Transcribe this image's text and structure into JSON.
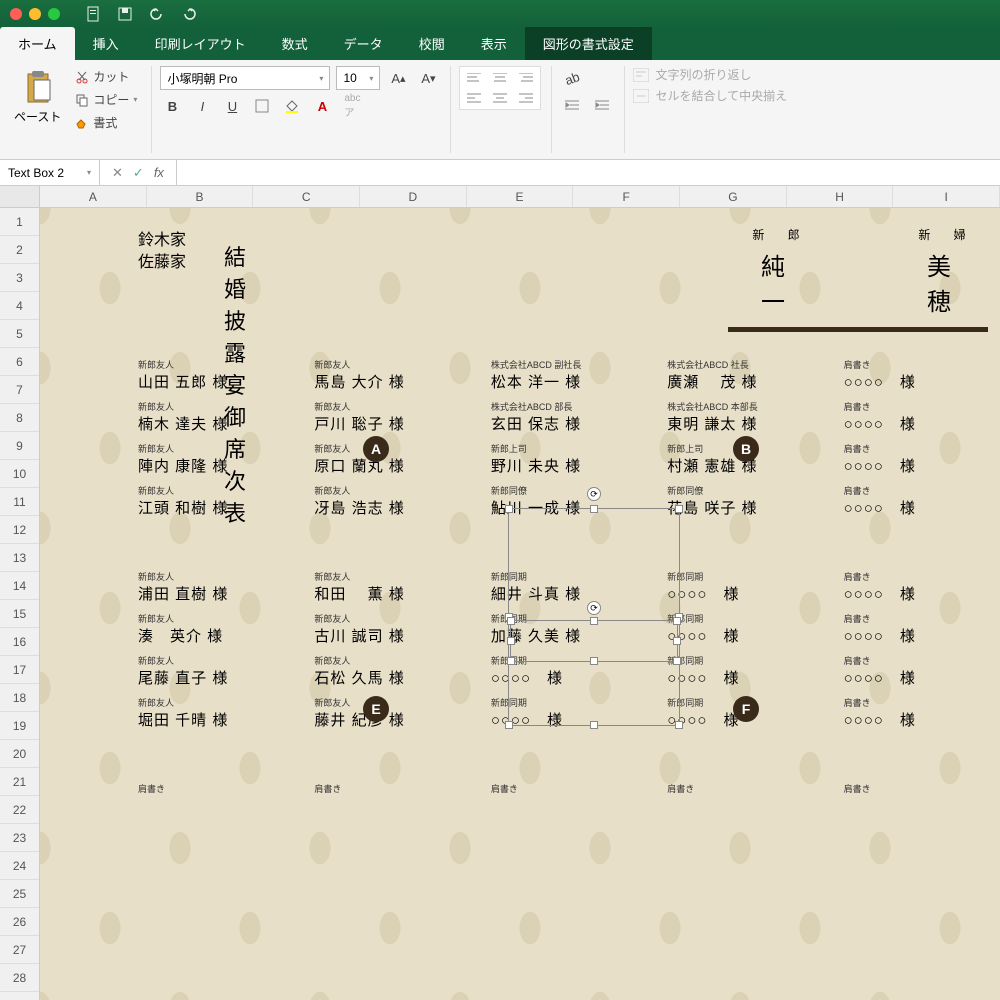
{
  "titlebar": {
    "icons": [
      "document",
      "save",
      "undo",
      "redo"
    ]
  },
  "tabs": {
    "items": [
      "ホーム",
      "挿入",
      "印刷レイアウト",
      "数式",
      "データ",
      "校閲",
      "表示",
      "図形の書式設定"
    ],
    "active": 0,
    "context": 7
  },
  "ribbon": {
    "paste": "ペースト",
    "cut": "カット",
    "copy": "コピー",
    "format": "書式",
    "font_name": "小塚明朝 Pro",
    "font_size": "10",
    "wrap": "文字列の折り返し",
    "merge": "セルを結合して中央揃え"
  },
  "formula": {
    "name_box": "Text Box 2",
    "fx": "fx"
  },
  "columns": [
    "A",
    "B",
    "C",
    "D",
    "E",
    "F",
    "G",
    "H",
    "I"
  ],
  "rows": [
    "1",
    "2",
    "3",
    "4",
    "5",
    "6",
    "7",
    "8",
    "9",
    "10",
    "11",
    "12",
    "13",
    "14",
    "15",
    "16",
    "17",
    "18",
    "19",
    "20",
    "21",
    "22",
    "23",
    "24",
    "25",
    "26",
    "27",
    "28"
  ],
  "doc": {
    "family1": "鈴木家",
    "family2": "佐藤家",
    "title": "結婚披露宴御席次表",
    "groom_label": "新 郎",
    "bride_label": "新 婦",
    "groom_name": "純　一",
    "bride_name": "美　穂",
    "table_labels": {
      "A": "A",
      "B": "B",
      "E": "E",
      "F": "F"
    },
    "tables": [
      [
        [
          {
            "r": "新郎友人",
            "n": "山田 五郎 様"
          },
          {
            "r": "新郎友人",
            "n": "楠木 達夫 様"
          },
          {
            "r": "新郎友人",
            "n": "陣内 康隆 様"
          },
          {
            "r": "新郎友人",
            "n": "江頭 和樹 様"
          }
        ],
        [
          {
            "r": "新郎友人",
            "n": "馬島 大介 様"
          },
          {
            "r": "新郎友人",
            "n": "戸川 聡子 様"
          },
          {
            "r": "新郎友人",
            "n": "原口 蘭丸 様"
          },
          {
            "r": "新郎友人",
            "n": "冴島 浩志 様"
          }
        ],
        [
          {
            "r": "株式会社ABCD 副社長",
            "n": "松本 洋一 様"
          },
          {
            "r": "株式会社ABCD 部長",
            "n": "玄田 保志 様"
          },
          {
            "r": "新郎上司",
            "n": "野川 未央 様"
          },
          {
            "r": "新郎同僚",
            "n": "鮎川 一成 様"
          }
        ],
        [
          {
            "r": "株式会社ABCD 社長",
            "n": "廣瀬　 茂 様"
          },
          {
            "r": "株式会社ABCD 本部長",
            "n": "東明 謙太 様"
          },
          {
            "r": "新郎上司",
            "n": "村瀬 憲雄 様"
          },
          {
            "r": "新郎同僚",
            "n": "花島 咲子 様"
          }
        ],
        [
          {
            "r": "肩書き",
            "n": "○○○○　様"
          },
          {
            "r": "肩書き",
            "n": "○○○○　様"
          },
          {
            "r": "肩書き",
            "n": "○○○○　様"
          },
          {
            "r": "肩書き",
            "n": "○○○○　様"
          }
        ]
      ],
      [
        [
          {
            "r": "新郎友人",
            "n": "浦田 直樹 様"
          },
          {
            "r": "新郎友人",
            "n": "湊　英介 様"
          },
          {
            "r": "新郎友人",
            "n": "尾藤 直子 様"
          },
          {
            "r": "新郎友人",
            "n": "堀田 千晴 様"
          }
        ],
        [
          {
            "r": "新郎友人",
            "n": "和田　 薫 様"
          },
          {
            "r": "新郎友人",
            "n": "古川 誠司 様"
          },
          {
            "r": "新郎友人",
            "n": "石松 久馬 様"
          },
          {
            "r": "新郎友人",
            "n": "藤井 紀彦 様"
          }
        ],
        [
          {
            "r": "新郎同期",
            "n": "細井 斗真 様"
          },
          {
            "r": "新郎同期",
            "n": "加藤 久美 様"
          },
          {
            "r": "新郎同期",
            "n": "○○○○　様"
          },
          {
            "r": "新郎同期",
            "n": "○○○○　様"
          }
        ],
        [
          {
            "r": "新郎同期",
            "n": "○○○○　様"
          },
          {
            "r": "新郎同期",
            "n": "○○○○　様"
          },
          {
            "r": "新郎同期",
            "n": "○○○○　様"
          },
          {
            "r": "新郎同期",
            "n": "○○○○　様"
          }
        ],
        [
          {
            "r": "肩書き",
            "n": "○○○○　様"
          },
          {
            "r": "肩書き",
            "n": "○○○○　様"
          },
          {
            "r": "肩書き",
            "n": "○○○○　様"
          },
          {
            "r": "肩書き",
            "n": "○○○○　様"
          }
        ]
      ],
      [
        [
          {
            "r": "肩書き",
            "n": ""
          }
        ],
        [
          {
            "r": "肩書き",
            "n": ""
          }
        ],
        [
          {
            "r": "肩書き",
            "n": ""
          }
        ],
        [
          {
            "r": "肩書き",
            "n": ""
          }
        ],
        [
          {
            "r": "肩書き",
            "n": ""
          }
        ]
      ]
    ]
  }
}
